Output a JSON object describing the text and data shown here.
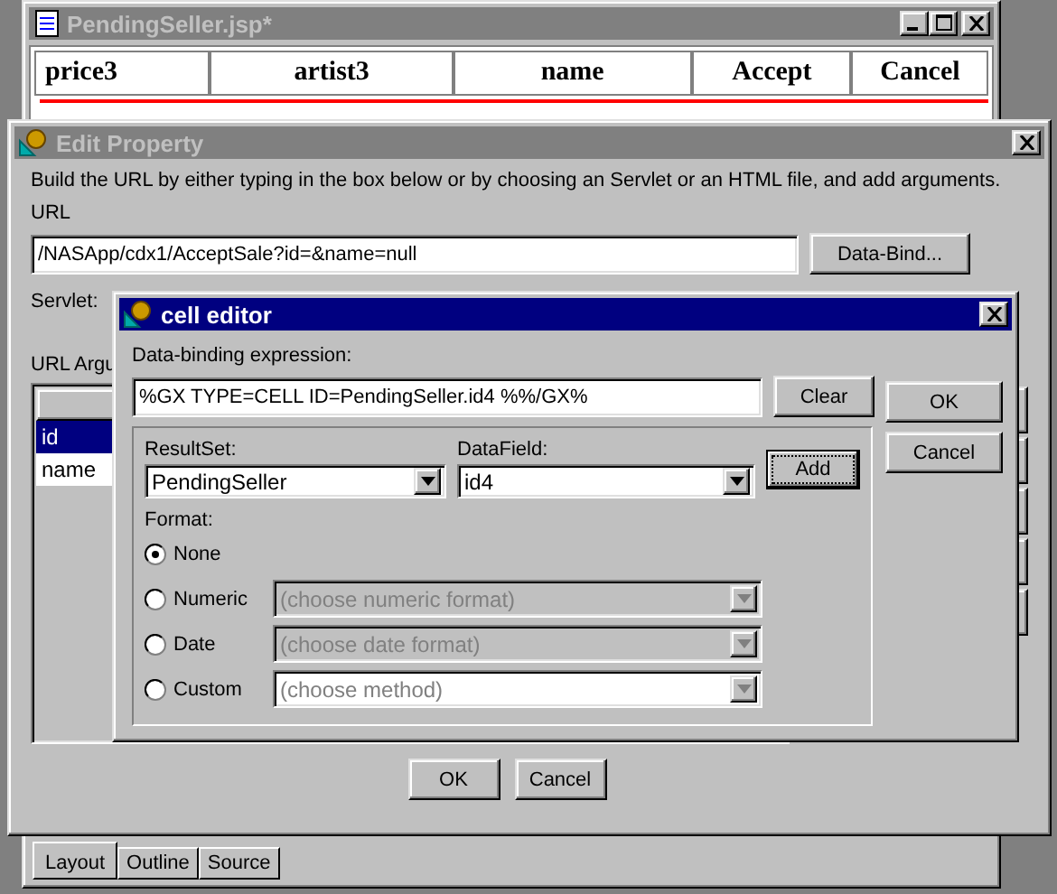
{
  "back_window": {
    "title": "PendingSeller.jsp*",
    "table": {
      "columns": [
        "price3",
        "artist3",
        "name",
        "Accept",
        "Cancel"
      ]
    },
    "tabs": [
      {
        "label": "Layout",
        "selected": true
      },
      {
        "label": "Outline",
        "selected": false
      },
      {
        "label": "Source",
        "selected": false
      }
    ]
  },
  "edit_property": {
    "title": "Edit Property",
    "instructions": "Build the URL by either typing in the box below or by choosing an Servlet or an HTML file, and add arguments.",
    "url_label": "URL",
    "url_value": "/NASApp/cdx1/AcceptSale?id=&name=null",
    "data_bind_button": "Data-Bind...",
    "servlet_label": "Servlet:",
    "arguments_label": "URL Argu",
    "arguments": [
      {
        "name": "id",
        "selected": true
      },
      {
        "name": "name",
        "selected": false
      }
    ],
    "buttons": [
      "OK",
      "Cancel"
    ]
  },
  "cell_editor": {
    "title": "cell editor",
    "expression_label": "Data-binding expression:",
    "expression_value": "%GX TYPE=CELL ID=PendingSeller.id4 %%/GX%",
    "clear_button": "Clear",
    "buttons": [
      "OK",
      "Cancel"
    ],
    "resultset": {
      "label": "ResultSet:",
      "value": "PendingSeller"
    },
    "datafield": {
      "label": "DataField:",
      "value": "id4"
    },
    "add_button": {
      "label": "Add",
      "focused": true
    },
    "format_label": "Format:",
    "formats": [
      {
        "label": "None",
        "selected": true
      },
      {
        "label": "Numeric",
        "selected": false,
        "placeholder": "(choose numeric format)",
        "disabled": true
      },
      {
        "label": "Date",
        "selected": false,
        "placeholder": "(choose date format)",
        "disabled": true
      },
      {
        "label": "Custom",
        "selected": false,
        "placeholder": "(choose method)",
        "disabled": false
      }
    ]
  }
}
